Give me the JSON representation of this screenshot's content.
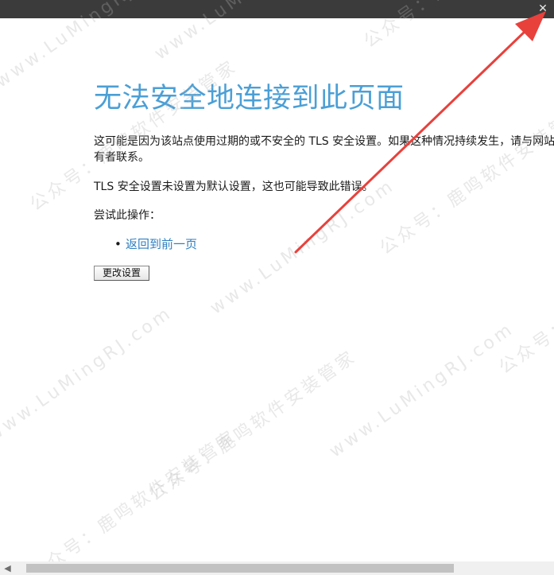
{
  "window": {
    "close_glyph": "✕"
  },
  "error_page": {
    "title": "无法安全地连接到此页面",
    "paragraph1": "这可能是因为该站点使用过期的或不安全的 TLS 安全设置。如果这种情况持续发生，请与网站所有者联系。",
    "paragraph2": "TLS 安全设置未设置为默认设置，这也可能导致此错误。",
    "try_label": "尝试此操作：",
    "actions": [
      {
        "label": "返回到前一页"
      }
    ],
    "change_settings_button": "更改设置"
  },
  "scrollbar": {
    "left_arrow_glyph": "◀"
  },
  "watermark": {
    "texts": [
      "公众号：鹿鸣软件安装管家",
      "www.LuMingRJ.com"
    ]
  },
  "colors": {
    "title": "#4b9fd6",
    "link": "#2f7fc1",
    "titlebar": "#3b3b3b",
    "annotation_arrow": "#e8413c"
  },
  "icons": [
    "close-icon",
    "chevron-left-icon"
  ]
}
